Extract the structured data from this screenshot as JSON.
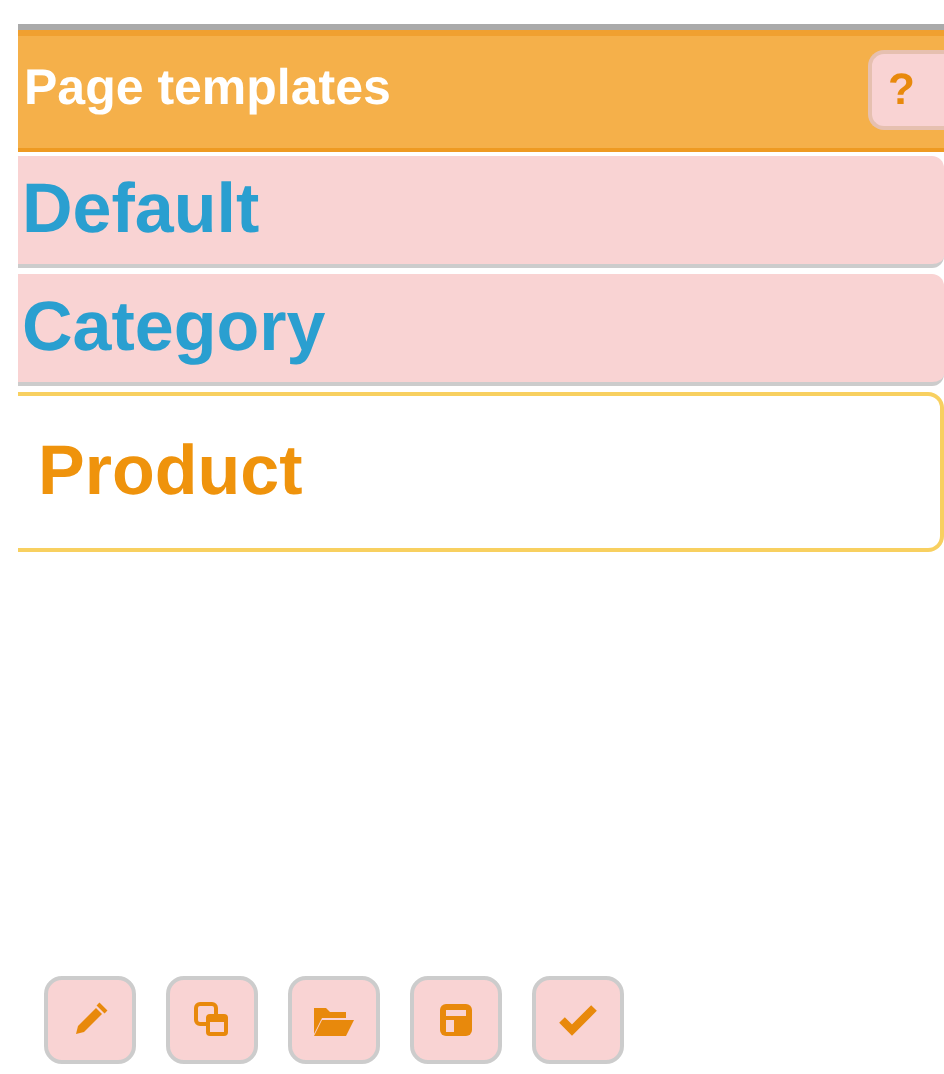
{
  "panel": {
    "title": "Page templates",
    "help": "?"
  },
  "templates": [
    {
      "label": "Default",
      "selected": false
    },
    {
      "label": "Category",
      "selected": false
    },
    {
      "label": "Product",
      "selected": true
    }
  ],
  "toolbar": [
    {
      "kind": "edit"
    },
    {
      "kind": "copy"
    },
    {
      "kind": "open"
    },
    {
      "kind": "save"
    },
    {
      "kind": "apply"
    }
  ]
}
